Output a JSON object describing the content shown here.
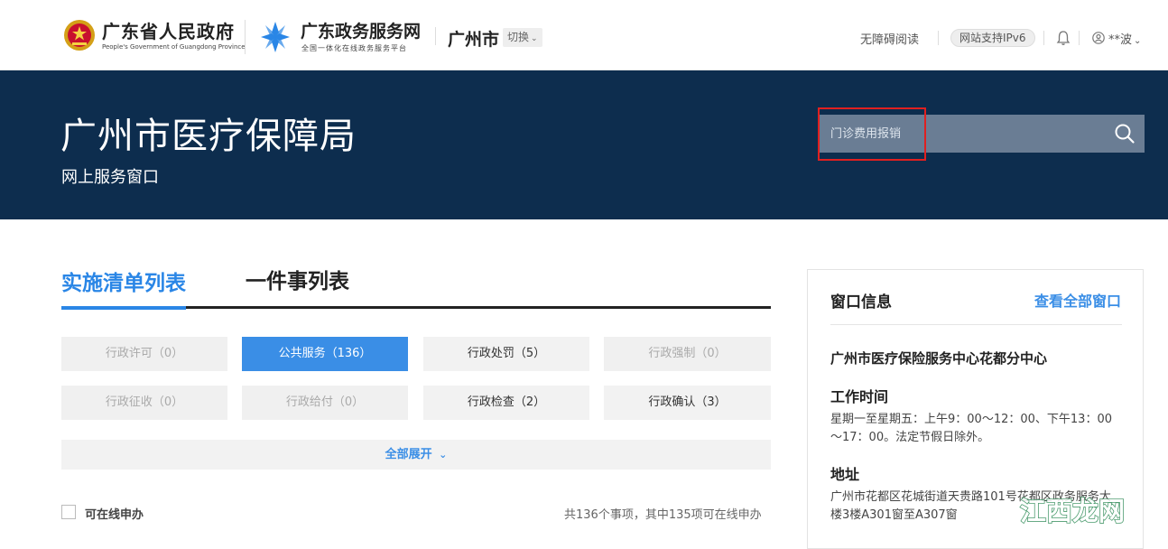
{
  "header": {
    "gov_name": "广东省人民政府",
    "gov_name_en": "People's Government of Guangdong Province",
    "service_name": "广东政务服务网",
    "service_subtitle": "全国一体化在线政务服务平台",
    "city": "广州市",
    "switch_label": "切换",
    "accessibility": "无障碍阅读",
    "ipv6": "网站支持IPv6",
    "user": "**波"
  },
  "banner": {
    "title": "广州市医疗保障局",
    "subtitle": "网上服务窗口",
    "search_placeholder": "门诊费用报销"
  },
  "tabs": [
    {
      "label": "实施清单列表",
      "active": true
    },
    {
      "label": "一件事列表",
      "active": false
    }
  ],
  "categories": [
    {
      "label": "行政许可（0）",
      "state": "disabled"
    },
    {
      "label": "公共服务（136）",
      "state": "active"
    },
    {
      "label": "行政处罚（5）",
      "state": "normal"
    },
    {
      "label": "行政强制（0）",
      "state": "disabled"
    },
    {
      "label": "行政征收（0）",
      "state": "disabled"
    },
    {
      "label": "行政给付（0）",
      "state": "disabled"
    },
    {
      "label": "行政检查（2）",
      "state": "normal"
    },
    {
      "label": "行政确认（3）",
      "state": "normal"
    }
  ],
  "expand_label": "全部展开",
  "filter": {
    "online_label": "可在线申办",
    "count_text": "共136个事项，其中135项可在线申办"
  },
  "window_panel": {
    "title": "窗口信息",
    "view_all": "查看全部窗口",
    "center_name": "广州市医疗保险服务中心花都分中心",
    "hours_label": "工作时间",
    "hours_text": "星期一至星期五：上午9：00～12：00、下午13：00～17：00。法定节假日除外。",
    "address_label": "地址",
    "address_text": "广州市花都区花城街道天贵路101号花都区政务服务大楼3楼A301窗至A307窗"
  },
  "watermark": "江西龙网",
  "colors": {
    "accent": "#3a8ee6",
    "banner": "#0d2d4e",
    "highlight": "#e02020"
  }
}
